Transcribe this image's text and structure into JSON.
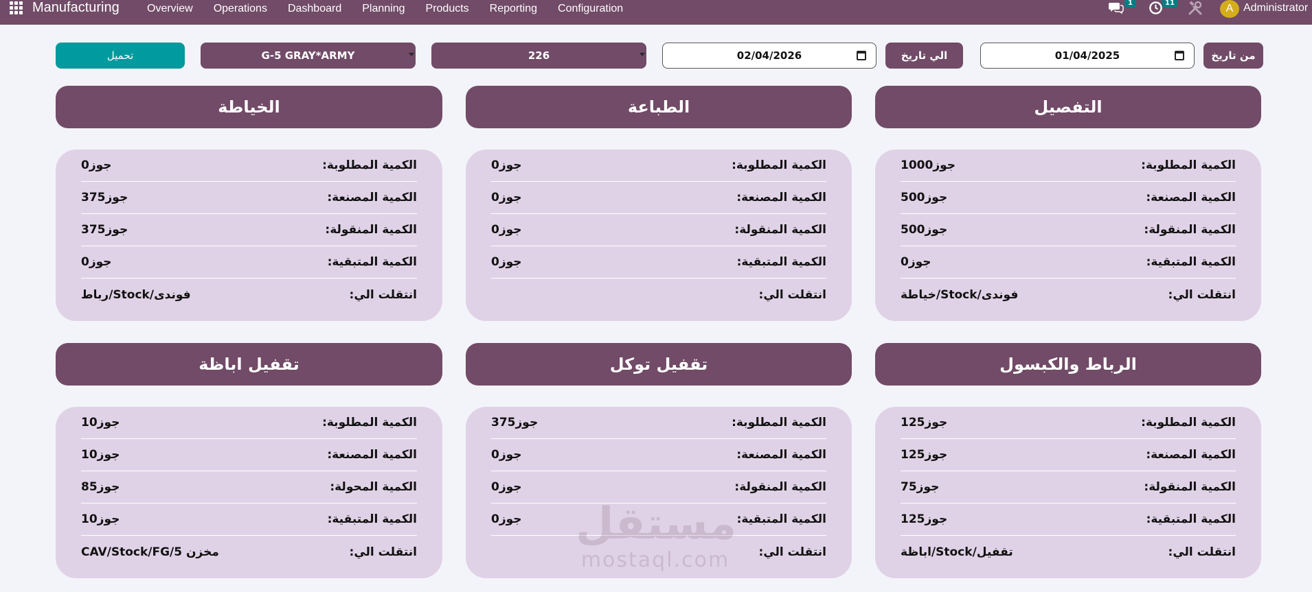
{
  "navbar": {
    "brand": "Manufacturing",
    "menu": [
      "Overview",
      "Operations",
      "Dashboard",
      "Planning",
      "Products",
      "Reporting",
      "Configuration"
    ],
    "chat_count": "1",
    "activity_count": "11",
    "avatar_letter": "A",
    "user": "Administrator"
  },
  "filters": {
    "from_label": "من تاريخ",
    "from_date": "01/04/2025",
    "to_label": "الي تاريخ",
    "to_date": "02/04/2026",
    "order": "226",
    "product": "G-5 GRAY*ARMY",
    "load_label": "تحميل"
  },
  "sections": [
    {
      "title": "التفصيل",
      "rows": [
        {
          "label": "الكمية المطلوبة:",
          "value": "جوز1000"
        },
        {
          "label": "الكمية المصنعة:",
          "value": "جوز500"
        },
        {
          "label": "الكمية المنقولة:",
          "value": "جوز500"
        },
        {
          "label": "الكمية المتبقية:",
          "value": "جوز0"
        },
        {
          "label": "انتقلت الي:",
          "value": "فوندى/Stock/خياطة"
        }
      ]
    },
    {
      "title": "الطباعة",
      "rows": [
        {
          "label": "الكمية المطلوبة:",
          "value": "جوز0"
        },
        {
          "label": "الكمية المصنعة:",
          "value": "جوز0"
        },
        {
          "label": "الكمية المنقولة:",
          "value": "جوز0"
        },
        {
          "label": "الكمية المتبقية:",
          "value": "جوز0"
        },
        {
          "label": "انتقلت الي:",
          "value": ""
        }
      ]
    },
    {
      "title": "الخياطة",
      "rows": [
        {
          "label": "الكمية المطلوبة:",
          "value": "جوز0"
        },
        {
          "label": "الكمية المصنعة:",
          "value": "جوز375"
        },
        {
          "label": "الكمية المنقولة:",
          "value": "جوز375"
        },
        {
          "label": "الكمية المتبقية:",
          "value": "جوز0"
        },
        {
          "label": "انتقلت الي:",
          "value": "فوندى/Stock/رباط"
        }
      ]
    },
    {
      "title": "الرباط والكبسول",
      "rows": [
        {
          "label": "الكمية المطلوبة:",
          "value": "جوز125"
        },
        {
          "label": "الكمية المصنعة:",
          "value": "جوز125"
        },
        {
          "label": "الكمية المنقولة:",
          "value": "جوز75"
        },
        {
          "label": "الكمية المتبقية:",
          "value": "جوز125"
        },
        {
          "label": "انتقلت الي:",
          "value": "تقفيل/Stock/اباظة"
        }
      ]
    },
    {
      "title": "تقفيل توكل",
      "rows": [
        {
          "label": "الكمية المطلوبة:",
          "value": "جوز375"
        },
        {
          "label": "الكمية المصنعة:",
          "value": "جوز0"
        },
        {
          "label": "الكمية المنقولة:",
          "value": "جوز0"
        },
        {
          "label": "الكمية المتبقية:",
          "value": "جوز0"
        },
        {
          "label": "انتقلت الي:",
          "value": ""
        }
      ]
    },
    {
      "title": "تقفيل اباظة",
      "rows": [
        {
          "label": "الكمية المطلوبة:",
          "value": "جوز10"
        },
        {
          "label": "الكمية المصنعة:",
          "value": "جوز10"
        },
        {
          "label": "الكمية المحولة:",
          "value": "جوز85"
        },
        {
          "label": "الكمية المتبقية:",
          "value": "جوز10"
        },
        {
          "label": "انتقلت الي:",
          "value": "مخزن CAV/Stock/FG/5"
        }
      ]
    }
  ],
  "watermark": {
    "arabic": "مستقل",
    "latin": "mostaql.com"
  },
  "colors": {
    "primary": "#714b67",
    "accent": "#019a9e",
    "card_bg": "#e0d2e6",
    "page_bg": "#f3f4f9"
  }
}
